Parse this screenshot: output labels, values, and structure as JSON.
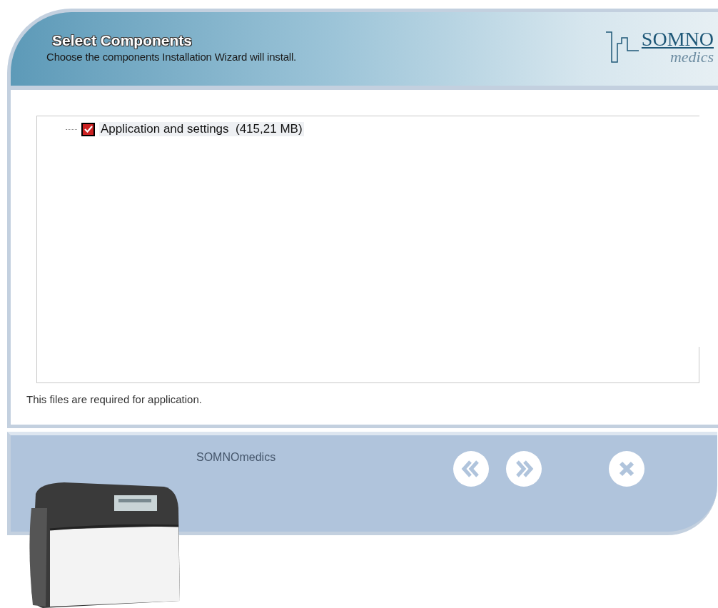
{
  "header": {
    "title": "Select Components",
    "subtitle": "Choose the components Installation Wizard will install."
  },
  "logo": {
    "top": "SOMNO",
    "bottom": "medics"
  },
  "tree": {
    "items": [
      {
        "label": "Application and settings  (415,21 MB)",
        "checked": true
      }
    ]
  },
  "description": "This files are required for application.",
  "footer": {
    "brand": "SOMNOmedics"
  },
  "buttons": [
    {
      "kind": "back"
    },
    {
      "kind": "next"
    },
    {
      "kind": "cancel"
    }
  ]
}
